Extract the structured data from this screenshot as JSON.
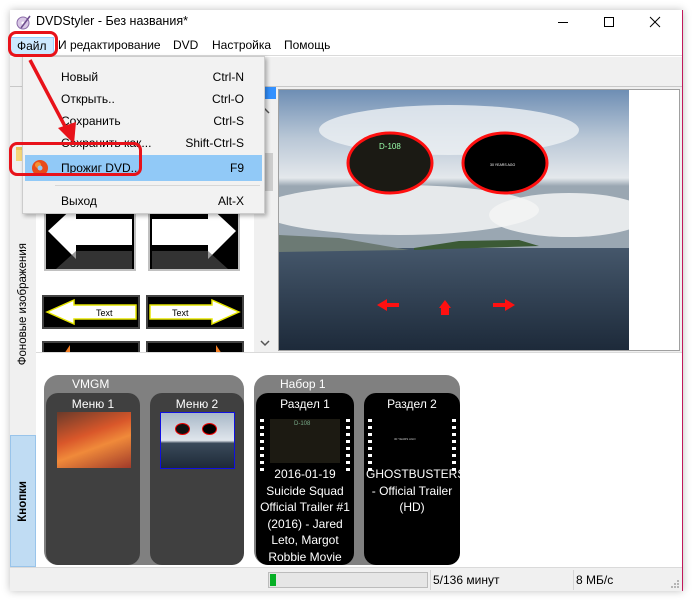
{
  "window": {
    "title": "DVDStyler - Без названия*",
    "accent_border": "#c2185b",
    "buttons": {
      "minimize": "minimize-icon",
      "maximize": "maximize-icon",
      "close": "close-icon"
    }
  },
  "menubar": {
    "items": [
      {
        "label": "Файл",
        "active": true
      },
      {
        "label": "И редактирование"
      },
      {
        "label": "DVD"
      },
      {
        "label": "Настройка"
      },
      {
        "label": "Помощь"
      }
    ]
  },
  "file_menu": {
    "items": [
      {
        "label": "Новый",
        "shortcut": "Ctrl-N"
      },
      {
        "label": "Открыть..",
        "shortcut": "Ctrl-O"
      },
      {
        "label": "Сохранить",
        "shortcut": "Ctrl-S"
      },
      {
        "label": "Сохранить как...",
        "shortcut": "Shift-Ctrl-S"
      },
      {
        "label": "Прожиг DVD...",
        "shortcut": "F9",
        "icon": "burn-disc-icon",
        "highlighted": true
      },
      {
        "label": "Выход",
        "shortcut": "Alt-X"
      }
    ]
  },
  "left_tabs": {
    "items": [
      {
        "label": "Фоновые изображения",
        "active": false
      },
      {
        "label": "Кнопки",
        "active": true
      }
    ]
  },
  "gallery": {
    "items": [
      {
        "type": "arrow-left-button"
      },
      {
        "type": "arrow-right-button"
      },
      {
        "type": "arrow-left-text-button",
        "label": "Text"
      },
      {
        "type": "arrow-right-text-button",
        "label": "Text"
      },
      {
        "type": "triangle-left-button"
      },
      {
        "type": "triangle-right-button"
      }
    ]
  },
  "preview": {
    "buttons": [
      {
        "type": "oval-thumbnail",
        "text": "D-108"
      },
      {
        "type": "oval-thumbnail",
        "text": "30 YEARS AGO"
      }
    ],
    "nav": [
      "prev-arrow",
      "home",
      "next-arrow"
    ]
  },
  "titleset": {
    "vmgm": {
      "label": "VMGM",
      "menus": [
        {
          "label": "Меню 1"
        },
        {
          "label": "Меню 2",
          "selected": true
        }
      ]
    },
    "set1": {
      "label": "Набор 1",
      "titles": [
        {
          "label": "Раздел 1",
          "desc": "2016-01-19 Suicide Squad Official Trailer #1 (2016) - Jared Leto, Margot Robbie Movie HD",
          "thumb_text": "D-108"
        },
        {
          "label": "Раздел 2",
          "desc": "GHOSTBUSTERS - Official Trailer (HD)",
          "thumb_text": "30 YEARS AGO"
        }
      ]
    }
  },
  "statusbar": {
    "progress_fraction": 0.0368,
    "duration": "5/136 минут",
    "bitrate": "8 МБ/с"
  },
  "annotations": {
    "color": "#e8121a"
  }
}
